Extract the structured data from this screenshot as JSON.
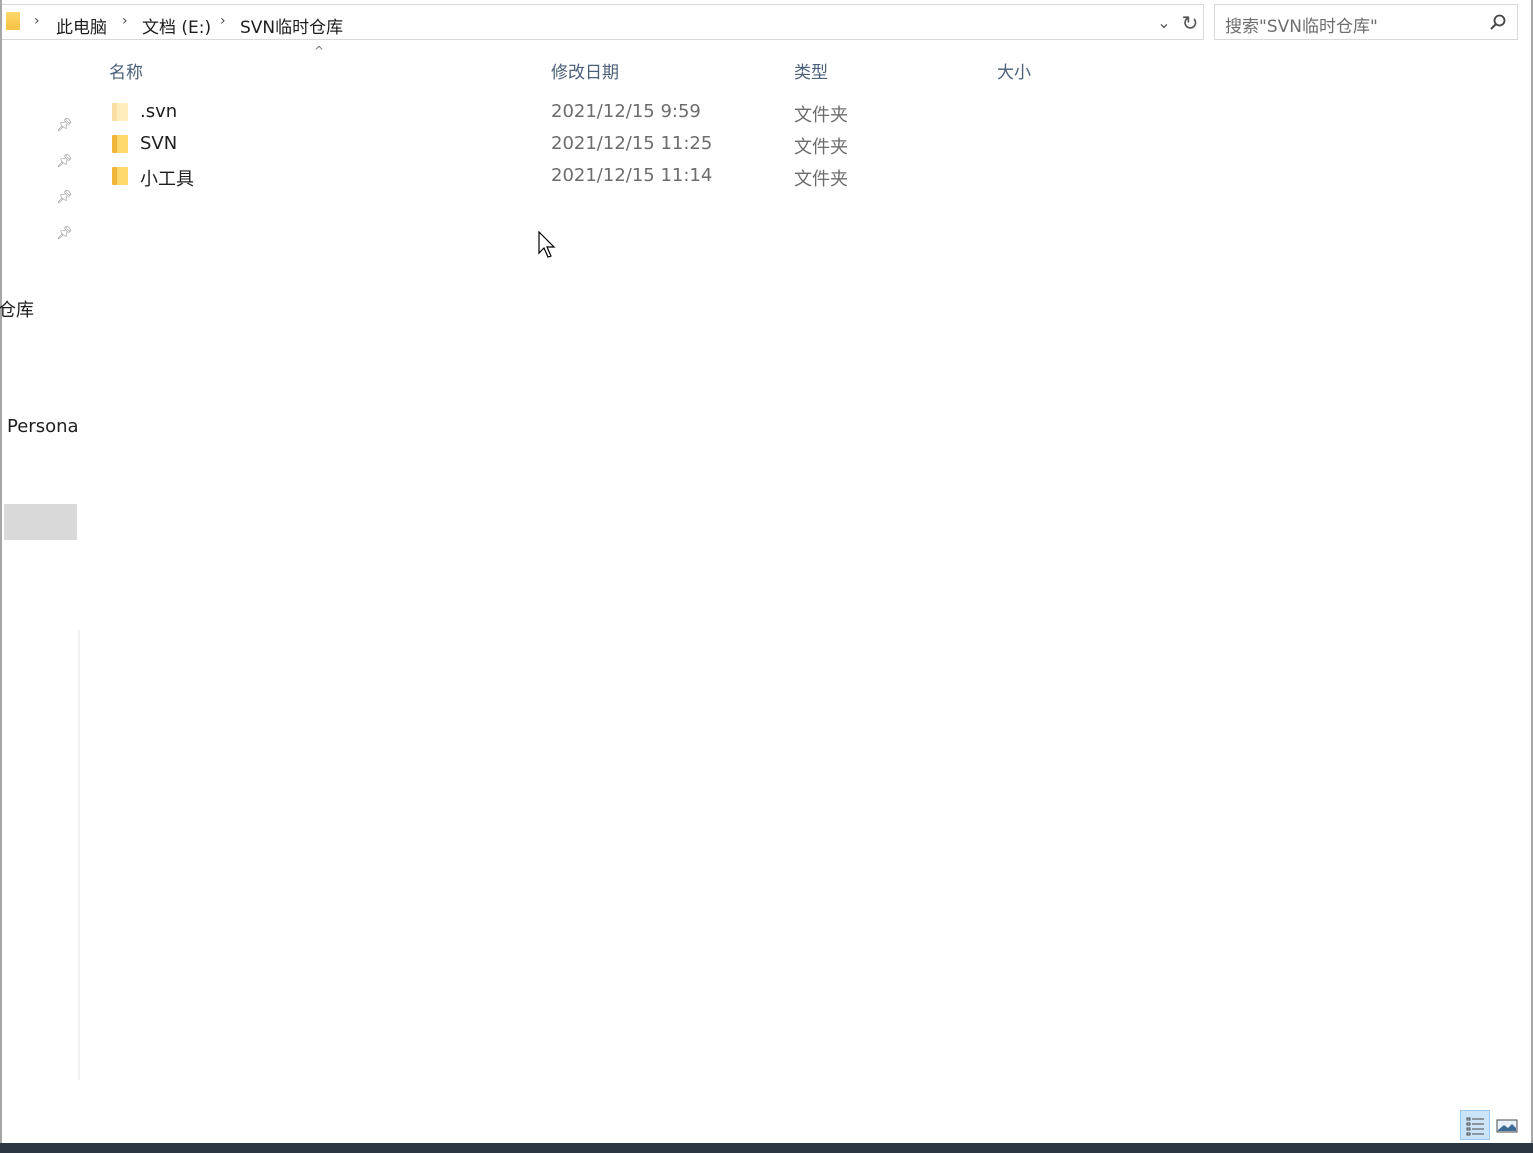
{
  "breadcrumb": {
    "items": [
      "此电脑",
      "文档 (E:)",
      "SVN临时仓库"
    ]
  },
  "search": {
    "placeholder": "搜索\"SVN临时仓库\""
  },
  "columns": {
    "name": "名称",
    "date": "修改日期",
    "type": "类型",
    "size": "大小"
  },
  "files": [
    {
      "name": ".svn",
      "date": "2021/12/15 9:59",
      "type": "文件夹",
      "hidden": true
    },
    {
      "name": "SVN",
      "date": "2021/12/15 11:25",
      "type": "文件夹",
      "hidden": false
    },
    {
      "name": "小工具",
      "date": "2021/12/15 11:14",
      "type": "文件夹",
      "hidden": false
    }
  ],
  "nav": {
    "fragment_repo": "仓库",
    "fragment_personal": "Persona"
  },
  "icons": {
    "folder": "folder-icon",
    "pin": "pin-icon",
    "search": "search-icon",
    "refresh": "refresh-icon",
    "dropdown": "chevron-down-icon",
    "details_view": "details-view-icon",
    "large_icons_view": "large-icons-view-icon"
  },
  "colors": {
    "header_text": "#4c607a",
    "folder_yellow": "#ffd86b",
    "selection": "#cce4f7",
    "taskbar": "#2b3640"
  }
}
